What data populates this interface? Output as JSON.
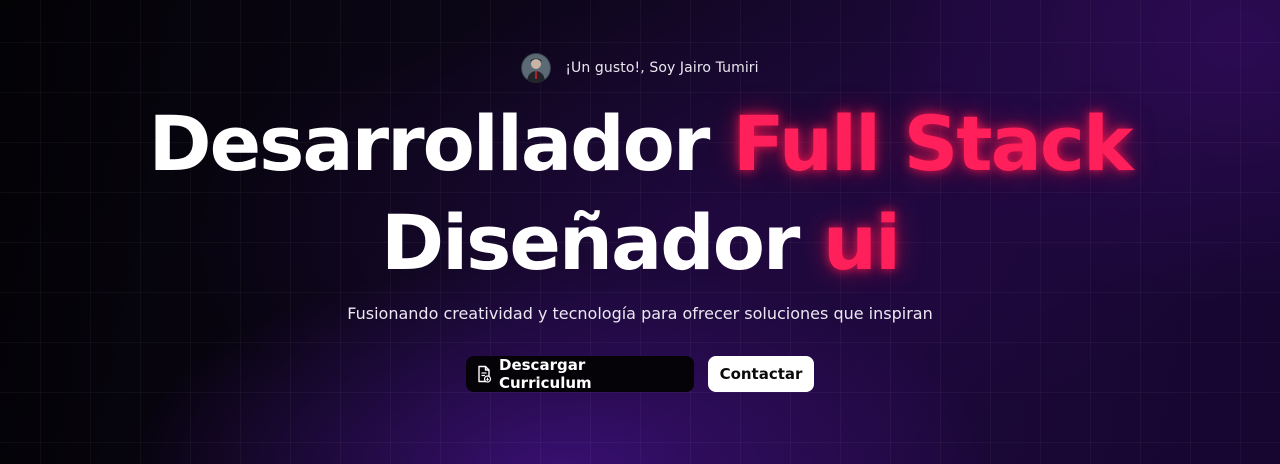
{
  "intro": {
    "avatar_icon": "avatar-portrait",
    "text": "¡Un gusto!, Soy Jairo Tumiri"
  },
  "headline": {
    "line1_text": "Desarrollador",
    "line1_accent": "Full Stack",
    "line2_text": "Diseñador",
    "line2_accent": "ui"
  },
  "subtitle": "Fusionando creatividad y tecnología para ofrecer soluciones que inspiran",
  "actions": {
    "download_icon": "document-download-icon",
    "download_label": "Descargar Curriculum",
    "contact_label": "Contactar"
  },
  "colors": {
    "accent": "#ff1f5a",
    "background": "#0a0612",
    "purple_glow": "#46128c"
  }
}
